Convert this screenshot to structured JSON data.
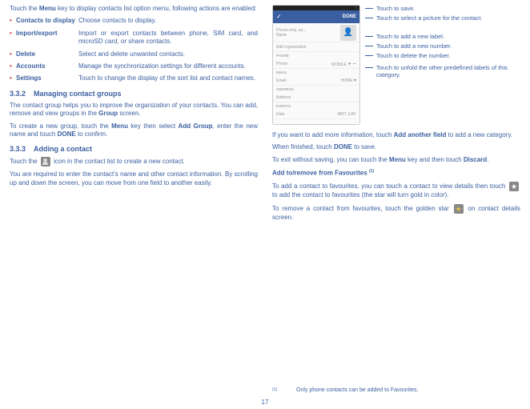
{
  "left": {
    "intro": "Touch the Menu key to display contacts list option menu, following actions are enabled:",
    "intro_bold": "Menu",
    "bullets": [
      {
        "label": "Contacts to display",
        "desc": "Choose contacts to display."
      },
      {
        "label": "Import/export",
        "desc": "Import or export contacts between phone, SIM card, and microSD card, or share contacts."
      },
      {
        "label": "Delete",
        "desc": "Select and delete unwanted contacts."
      },
      {
        "label": "Accounts",
        "desc": "Manage the synchronization settings for different accounts."
      },
      {
        "label": "Settings",
        "desc": "Touch to change the display of the sort list and contact names."
      }
    ],
    "h332_num": "3.3.2",
    "h332": "Managing contact groups",
    "p332a": "The contact group helps you to improve the organization of your contacts. You can add, remove and view groups in the Group screen.",
    "p332a_bold": "Group",
    "p332b": "To create a new group, touch the Menu key then select Add Group, enter the new name and touch DONE to confirm.",
    "p332b_b1": "Menu",
    "p332b_b2": "Add Group",
    "p332b_b3": "DONE",
    "h333_num": "3.3.3",
    "h333": "Adding a contact",
    "p333a_pre": "Touch the ",
    "p333a_post": " icon in the contact list to create a new contact.",
    "p333b": "You are required to enter the contact's name and other contact information. By scrolling up and down the screen, you can move from one field to another easily."
  },
  "right": {
    "phone": {
      "done_label": "DONE",
      "name": "Name",
      "phone_only": "Phone-only, un...",
      "add_org": "Add organization",
      "section_phone": "PHONE",
      "phone_hint": "Phone",
      "mobile": "MOBILE",
      "section_email": "EMAIL",
      "email_hint": "Email",
      "home": "HOME",
      "section_address": "ADDRESS",
      "address_hint": "Address",
      "section_events": "EVENTS",
      "date": "Date",
      "birthday": "BIRT..DAY"
    },
    "callouts": [
      "Touch to save.",
      "Touch to select a picture for the contact.",
      "Touch to add a new label.",
      "Touch to add a new number.",
      "Touch to delete the number.",
      "Touch to unfold the other predefined labels of this category."
    ],
    "p1_pre": "If you want to add more information, touch ",
    "p1_bold": "Add another field",
    "p1_post": " to add a new category.",
    "p2_pre": "When finished, touch ",
    "p2_bold": "DONE",
    "p2_post": " to save.",
    "p3_pre": "To exit without saving, you can touch the ",
    "p3_b1": "Menu",
    "p3_mid": " key and then touch ",
    "p3_b2": "Discard",
    "p3_post": ".",
    "h_fav": "Add to/remove from Favourites",
    "fav_ref": "(1)",
    "p4_pre": "To add a contact to favourites, you can touch a contact to view details then touch ",
    "p4_post": " to add the contact to favourites (the star will turn gold in color).",
    "p5_pre": "To remove a contact from favourites, touch the golden star ",
    "p5_post": " on contact details screen.",
    "footnote_num": "(1)",
    "footnote": "Only phone contacts can be added to Favourites."
  },
  "page_num": "17"
}
